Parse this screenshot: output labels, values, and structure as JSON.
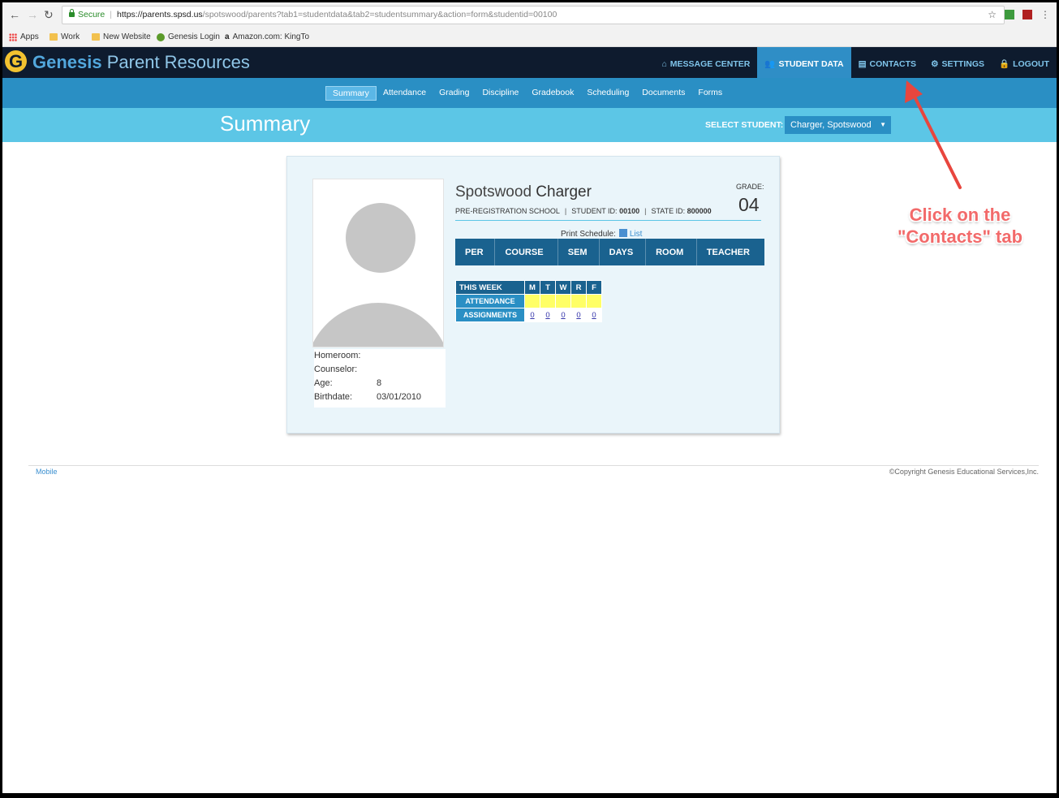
{
  "browser": {
    "secure_label": "Secure",
    "url_host": "https://parents.spsd.us",
    "url_rest": "/spotswood/parents?tab1=studentdata&tab2=studentsummary&action=form&studentid=00100",
    "bookmarks": [
      {
        "label": "Apps",
        "icon": "apps-grid-icon"
      },
      {
        "label": "Work",
        "icon": "folder-icon"
      },
      {
        "label": "New Website",
        "icon": "folder-icon"
      },
      {
        "label": "Genesis Login",
        "icon": "genesis-icon"
      },
      {
        "label": "Amazon.com: KingTo",
        "icon": "amazon-icon"
      }
    ]
  },
  "header": {
    "logo_letter": "G",
    "brand": "Genesis",
    "app_title": "Parent Resources",
    "nav": [
      {
        "label": "MESSAGE CENTER",
        "icon": "home-icon",
        "glyph": "⌂",
        "active": false
      },
      {
        "label": "STUDENT DATA",
        "icon": "users-icon",
        "glyph": "👥",
        "active": true
      },
      {
        "label": "CONTACTS",
        "icon": "address-book-icon",
        "glyph": "▤",
        "active": false
      },
      {
        "label": "SETTINGS",
        "icon": "gear-icon",
        "glyph": "⚙",
        "active": false
      },
      {
        "label": "LOGOUT",
        "icon": "lock-icon",
        "glyph": "🔒",
        "active": false
      }
    ]
  },
  "subnav": {
    "tabs": [
      "Summary",
      "Attendance",
      "Grading",
      "Discipline",
      "Gradebook",
      "Scheduling",
      "Documents",
      "Forms"
    ],
    "active": "Summary"
  },
  "page": {
    "title": "Summary",
    "select_student_label": "SELECT STUDENT:",
    "selected_student": "Charger, Spotswood"
  },
  "student": {
    "first_name": "Spotswood",
    "last_name": "Charger",
    "grade_label": "GRADE:",
    "grade": "04",
    "school": "PRE-REGISTRATION SCHOOL",
    "student_id_label": "STUDENT ID:",
    "student_id": "00100",
    "state_id_label": "STATE ID:",
    "state_id": "800000",
    "details": [
      {
        "label": "Homeroom:",
        "value": ""
      },
      {
        "label": "Counselor:",
        "value": ""
      },
      {
        "label": "Age:",
        "value": "8"
      },
      {
        "label": "Birthdate:",
        "value": "03/01/2010"
      }
    ]
  },
  "schedule": {
    "print_label": "Print Schedule:",
    "list_link": "List",
    "columns": [
      "PER",
      "COURSE",
      "SEM",
      "DAYS",
      "ROOM",
      "TEACHER"
    ]
  },
  "week": {
    "header": "THIS WEEK",
    "days": [
      "M",
      "T",
      "W",
      "R",
      "F"
    ],
    "attendance_label": "ATTENDANCE",
    "assignments_label": "ASSIGNMENTS",
    "assignments": [
      "0",
      "0",
      "0",
      "0",
      "0"
    ]
  },
  "footer": {
    "mobile": "Mobile",
    "copyright": "©Copyright Genesis Educational Services,Inc."
  },
  "annotation": {
    "line1": "Click on the",
    "line2": "\"Contacts\" tab",
    "color": "#f26a6a"
  }
}
